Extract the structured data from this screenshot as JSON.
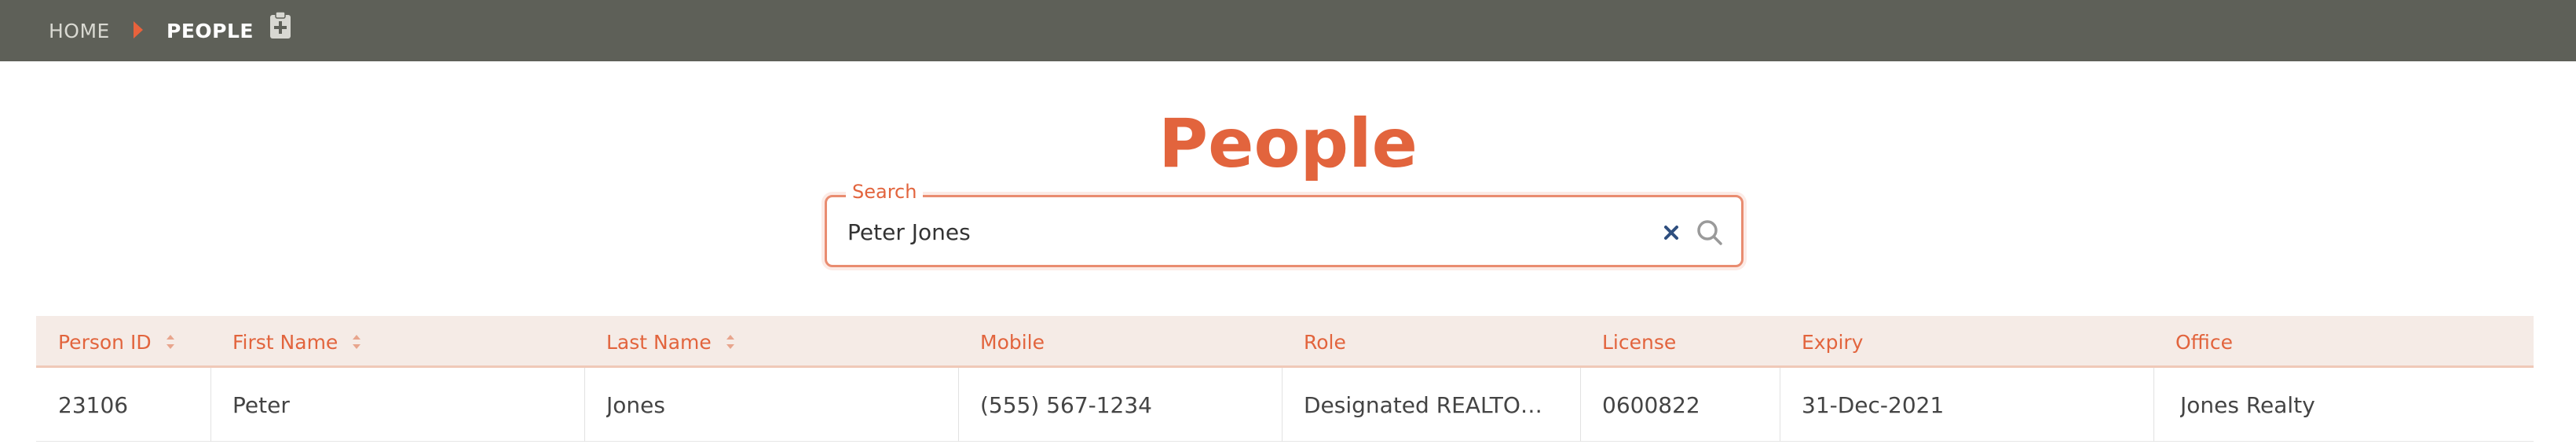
{
  "breadcrumb": {
    "home": "HOME",
    "current": "PEOPLE"
  },
  "icons": {
    "clipboard": "clipboard-plus-icon",
    "separator": "caret-right-icon",
    "clear": "close-icon",
    "search": "search-icon"
  },
  "page": {
    "title": "People"
  },
  "search": {
    "legend": "Search",
    "value": "Peter Jones",
    "placeholder": ""
  },
  "table": {
    "columns": [
      {
        "label": "Person ID",
        "sortable": true
      },
      {
        "label": "First Name",
        "sortable": true
      },
      {
        "label": "Last Name",
        "sortable": true
      },
      {
        "label": "Mobile",
        "sortable": false
      },
      {
        "label": "Role",
        "sortable": false
      },
      {
        "label": "License",
        "sortable": false
      },
      {
        "label": "Expiry",
        "sortable": false
      },
      {
        "label": "Office",
        "sortable": false
      }
    ],
    "rows": [
      [
        "23106",
        "Peter",
        "Jones",
        "(555) 567-1234",
        "Designated REALTO…",
        "0600822",
        "31-Dec-2021",
        "Jones Realty"
      ]
    ]
  },
  "colors": {
    "topbar": "#5e6058",
    "accent": "#e2643d",
    "header_bg": "#f5ebe6"
  }
}
